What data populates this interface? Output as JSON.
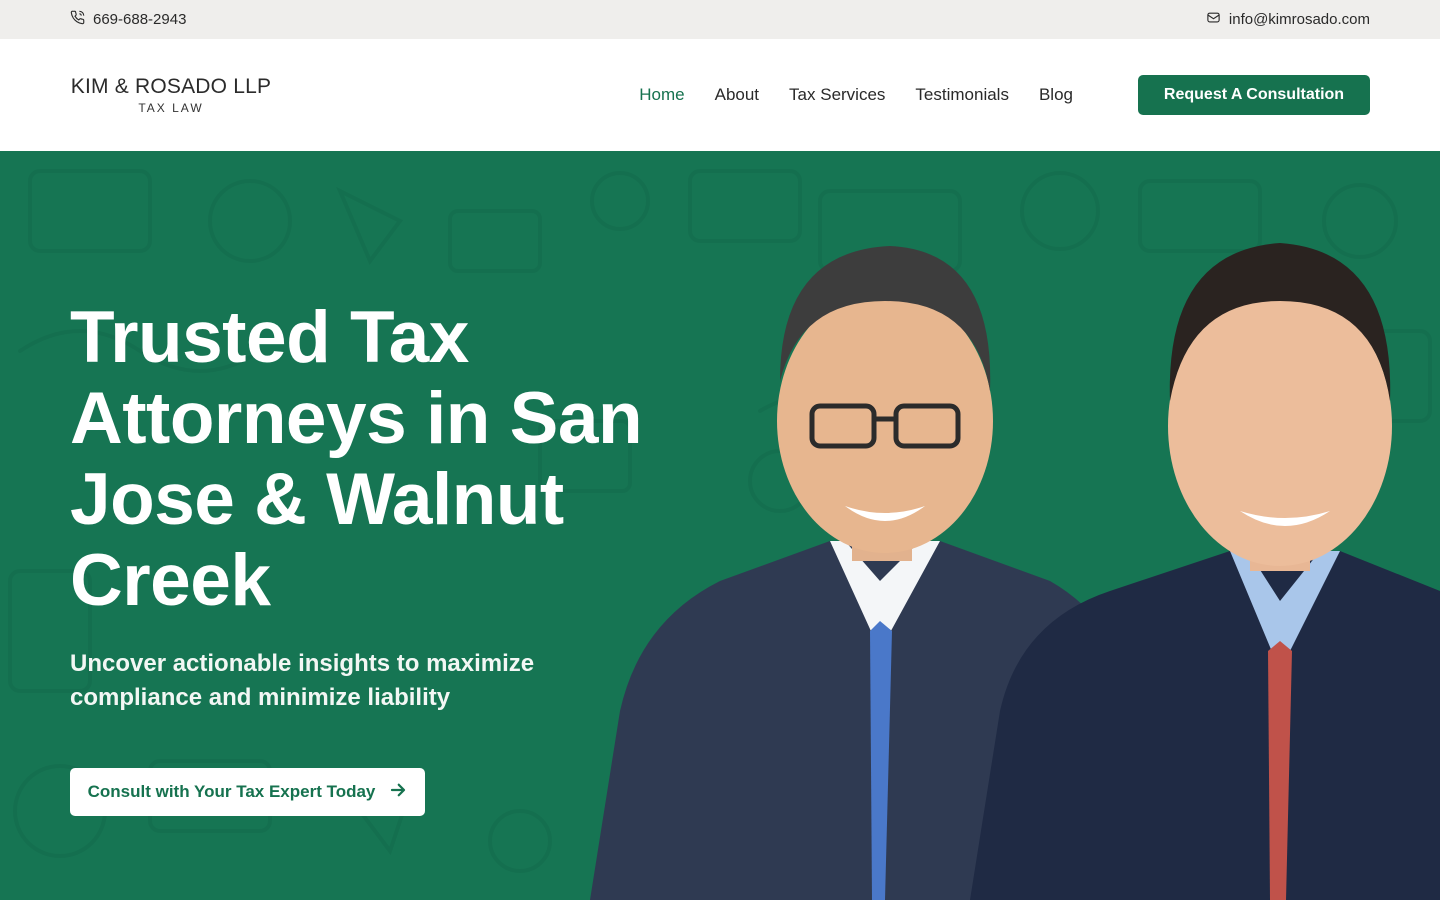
{
  "topbar": {
    "phone": "669-688-2943",
    "email": "info@kimrosado.com",
    "phone_icon": "phone-icon",
    "email_icon": "mail-icon"
  },
  "logo": {
    "name": "KIM & ROSADO LLP",
    "tagline": "TAX LAW"
  },
  "nav": {
    "items": [
      {
        "label": "Home",
        "active": true
      },
      {
        "label": "About"
      },
      {
        "label": "Tax Services"
      },
      {
        "label": "Testimonials"
      },
      {
        "label": "Blog"
      }
    ],
    "cta_label": "Request A Consultation"
  },
  "hero": {
    "title": "Trusted Tax Attorneys in San Jose & Walnut Creek",
    "subtitle": "Uncover actionable insights to maximize compliance and minimize liability",
    "button_label": "Consult with Your Tax Expert Today",
    "button_icon": "arrow-right-icon"
  },
  "colors": {
    "brand_green": "#16724f",
    "hero_bg": "#167553",
    "topbar_bg": "#efeeec"
  }
}
